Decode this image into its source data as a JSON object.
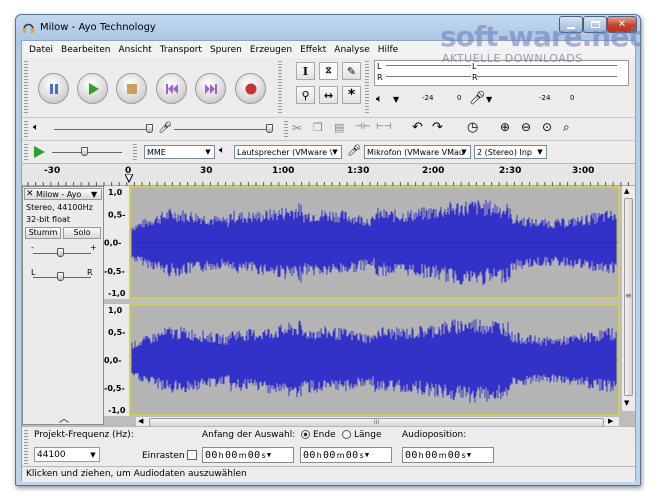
{
  "window": {
    "title": "Milow - Ayo Technology"
  },
  "menu": [
    "Datei",
    "Bearbeiten",
    "Ansicht",
    "Transport",
    "Spuren",
    "Erzeugen",
    "Effekt",
    "Analyse",
    "Hilfe"
  ],
  "watermark": {
    "brand": "soft-ware.net",
    "tagline": "AKTUELLE DOWNLOADS"
  },
  "meters": {
    "out_channels": [
      "L",
      "R"
    ],
    "in_channels": [
      "L",
      "R"
    ],
    "out_scale": [
      "-24",
      "0"
    ],
    "in_scale": [
      "-24",
      "0"
    ]
  },
  "device": {
    "host": "MME",
    "output": "Lautsprecher (VMware \\",
    "input": "Mikrofon (VMware VMau",
    "channels": "2 (Stereo) Inp"
  },
  "ruler": {
    "labels": [
      "-30",
      "0",
      "30",
      "1:00",
      "1:30",
      "2:00",
      "2:30",
      "3:00"
    ]
  },
  "track": {
    "name": "Milow - Ayo",
    "info1": "Stereo, 44100Hz",
    "info2": "32-bit float",
    "mute": "Stumm",
    "solo": "Solo",
    "gain_minus": "-",
    "gain_plus": "+",
    "pan_left": "L",
    "pan_right": "R",
    "scale": [
      "1,0",
      "0,5-",
      "0,0-",
      "-0,5-",
      "-1,0"
    ]
  },
  "hscroll_label": "III",
  "selection": {
    "rate_label": "Projekt-Frequenz (Hz):",
    "rate_value": "44100",
    "start_label": "Anfang der Auswahl:",
    "end_option": "Ende",
    "length_option": "Länge",
    "snap_label": "Einrasten",
    "pos_label": "Audioposition:",
    "start_time": [
      "00",
      "00",
      "00"
    ],
    "end_time": [
      "00",
      "00",
      "00"
    ],
    "audio_time": [
      "00",
      "00",
      "00"
    ],
    "units": [
      "h",
      "m",
      "s"
    ]
  },
  "status": "Klicken und ziehen, um Audiodaten auszuwählen",
  "colors": {
    "waveform": "#3232c8",
    "wave_bg": "#b4b4b4",
    "play": "#2ea12e",
    "record": "#c83232",
    "pause": "#4a6fc7",
    "skip": "#9966cc"
  }
}
